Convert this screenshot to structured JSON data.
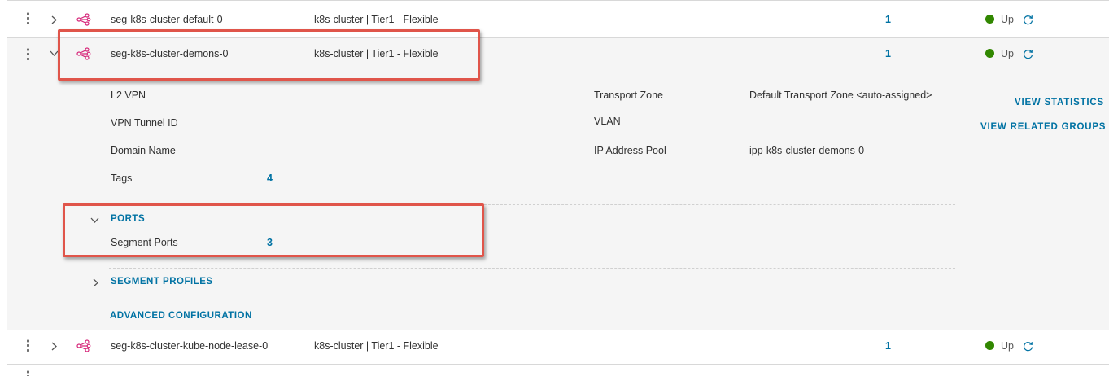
{
  "rows": {
    "top": {
      "name": "seg-k8s-cluster-default-0",
      "connectivity": "k8s-cluster | Tier1 - Flexible",
      "count": "1",
      "status": "Up"
    },
    "expanded": {
      "name": "seg-k8s-cluster-demons-0",
      "connectivity": "k8s-cluster | Tier1 - Flexible",
      "count": "1",
      "status": "Up"
    },
    "bottom": {
      "name": "seg-k8s-cluster-kube-node-lease-0",
      "connectivity": "k8s-cluster | Tier1 - Flexible",
      "count": "1",
      "status": "Up"
    }
  },
  "details": {
    "l2vpn_label": "L2 VPN",
    "vpn_tunnel_label": "VPN Tunnel ID",
    "domain_name_label": "Domain Name",
    "tags_label": "Tags",
    "tags_value": "4",
    "transport_zone_label": "Transport Zone",
    "transport_zone_value": "Default Transport Zone <auto-assigned>",
    "vlan_label": "VLAN",
    "ip_pool_label": "IP Address Pool",
    "ip_pool_value": "ipp-k8s-cluster-demons-0"
  },
  "actions": {
    "view_statistics": "VIEW STATISTICS",
    "view_related_groups": "VIEW RELATED GROUPS"
  },
  "ports": {
    "header": "PORTS",
    "segment_ports_label": "Segment Ports",
    "segment_ports_value": "3"
  },
  "segment_profiles": "SEGMENT PROFILES",
  "advanced_configuration": "ADVANCED CONFIGURATION",
  "colors": {
    "link": "#0072a3",
    "status_up": "#318700",
    "highlight": "#e0554a",
    "segment_icon": "#d6287a"
  }
}
